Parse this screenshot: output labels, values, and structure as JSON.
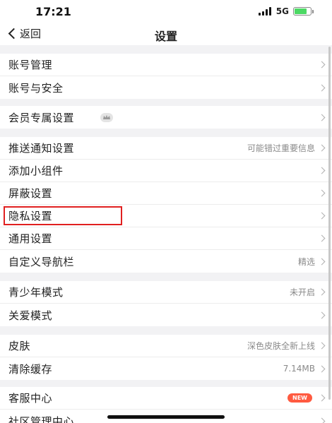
{
  "status_bar": {
    "time": "17:21",
    "network": "5G"
  },
  "nav": {
    "back_label": "返回",
    "title": "设置"
  },
  "sections": [
    {
      "rows": [
        {
          "label": "账号管理",
          "value": ""
        },
        {
          "label": "账号与安全",
          "value": ""
        }
      ]
    },
    {
      "rows": [
        {
          "label": "会员专属设置",
          "value": ""
        }
      ]
    },
    {
      "rows": [
        {
          "label": "推送通知设置",
          "value": "可能错过重要信息"
        },
        {
          "label": "添加小组件",
          "value": ""
        },
        {
          "label": "屏蔽设置",
          "value": ""
        },
        {
          "label": "隐私设置",
          "value": ""
        },
        {
          "label": "通用设置",
          "value": ""
        },
        {
          "label": "自定义导航栏",
          "value": "精选"
        }
      ]
    },
    {
      "rows": [
        {
          "label": "青少年模式",
          "value": "未开启"
        },
        {
          "label": "关爱模式",
          "value": ""
        }
      ]
    },
    {
      "rows": [
        {
          "label": "皮肤",
          "value": "深色皮肤全新上线"
        },
        {
          "label": "清除缓存",
          "value": "7.14MB"
        }
      ]
    },
    {
      "rows": [
        {
          "label": "客服中心",
          "value": "",
          "badge": "NEW"
        },
        {
          "label": "社区管理中心",
          "value": ""
        }
      ]
    }
  ],
  "colors": {
    "highlight": "#e02020",
    "badge": "#ff5a40",
    "background": "#f2f2f4"
  }
}
